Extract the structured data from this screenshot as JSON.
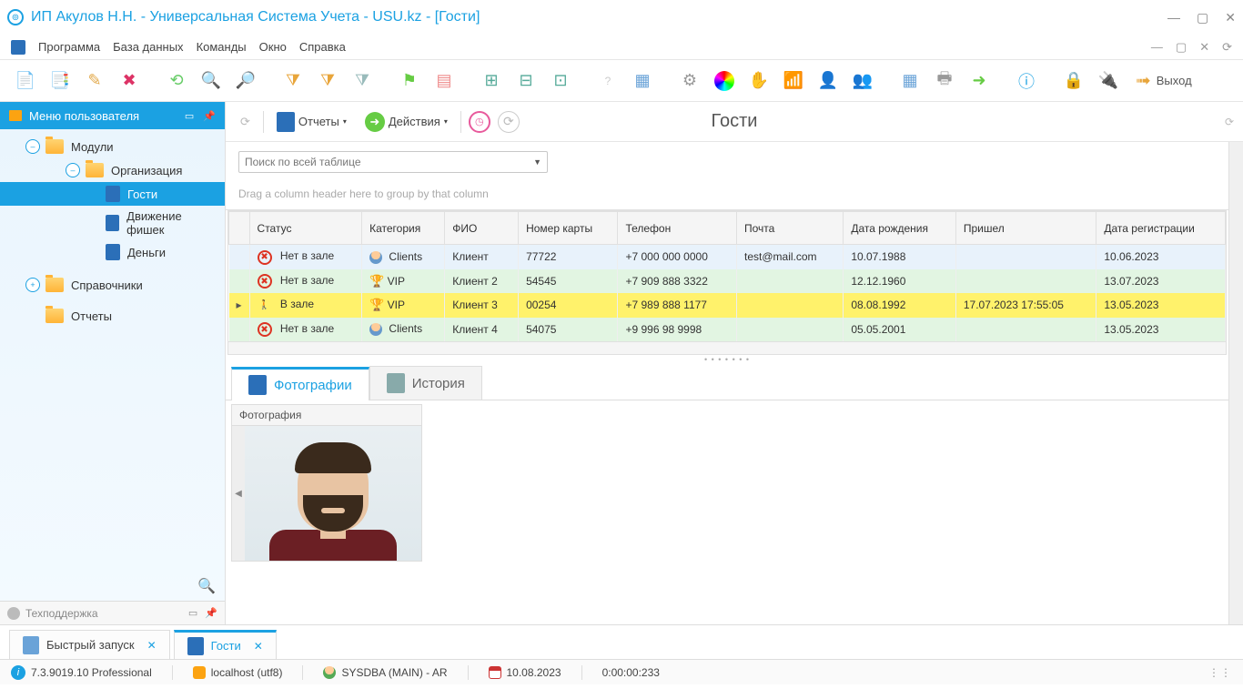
{
  "window": {
    "title": "ИП Акулов Н.Н. - Универсальная Система Учета - USU.kz - [Гости]"
  },
  "menubar": {
    "items": [
      "Программа",
      "База данных",
      "Команды",
      "Окно",
      "Справка"
    ]
  },
  "toolbar": {
    "exit": "Выход"
  },
  "sidebar": {
    "title": "Меню пользователя",
    "tree": {
      "modules": "Модули",
      "organization": "Организация",
      "guests": "Гости",
      "chips": "Движение фишек",
      "money": "Деньги",
      "refs": "Справочники",
      "reports": "Отчеты"
    },
    "support": "Техподдержка"
  },
  "subtoolbar": {
    "reports": "Отчеты",
    "actions": "Действия",
    "title": "Гости"
  },
  "search": {
    "placeholder": "Поиск по всей таблице"
  },
  "grid": {
    "group_hint": "Drag a column header here to group by that column",
    "columns": [
      "Статус",
      "Категория",
      "ФИО",
      "Номер карты",
      "Телефон",
      "Почта",
      "Дата рождения",
      "Пришел",
      "Дата регистрации"
    ],
    "rows": [
      {
        "status": "Нет в зале",
        "status_icon": "no",
        "cat": "Clients",
        "cat_icon": "client",
        "fio": "Клиент",
        "card": "77722",
        "tel": "+7 000 000 0000",
        "mail": "test@mail.com",
        "dob": "10.07.1988",
        "came": "",
        "reg": "10.06.2023",
        "cls": "row-blue"
      },
      {
        "status": "Нет в зале",
        "status_icon": "no",
        "cat": "VIP",
        "cat_icon": "vip",
        "fio": "Клиент 2",
        "card": "54545",
        "tel": "+7 909 888 3322",
        "mail": "",
        "dob": "12.12.1960",
        "came": "",
        "reg": "13.07.2023",
        "cls": "row-green"
      },
      {
        "status": "В зале",
        "status_icon": "yes",
        "cat": "VIP",
        "cat_icon": "vip",
        "fio": "Клиент 3",
        "card": "00254",
        "tel": "+7 989 888 1177",
        "mail": "",
        "dob": "08.08.1992",
        "came": "17.07.2023 17:55:05",
        "reg": "13.05.2023",
        "cls": "row-yellow"
      },
      {
        "status": "Нет в зале",
        "status_icon": "no",
        "cat": "Clients",
        "cat_icon": "client",
        "fio": "Клиент 4",
        "card": "54075",
        "tel": "+9 996 98 9998",
        "mail": "",
        "dob": "05.05.2001",
        "came": "",
        "reg": "13.05.2023",
        "cls": "row-green"
      }
    ]
  },
  "detail_tabs": {
    "photos": "Фотографии",
    "history": "История",
    "photo_header": "Фотография"
  },
  "bottom_tabs": {
    "quick": "Быстрый запуск",
    "guests": "Гости"
  },
  "statusbar": {
    "version": "7.3.9019.10 Professional",
    "host": "localhost (utf8)",
    "user": "SYSDBA (MAIN) - AR",
    "date": "10.08.2023",
    "timer": "0:00:00:233"
  }
}
